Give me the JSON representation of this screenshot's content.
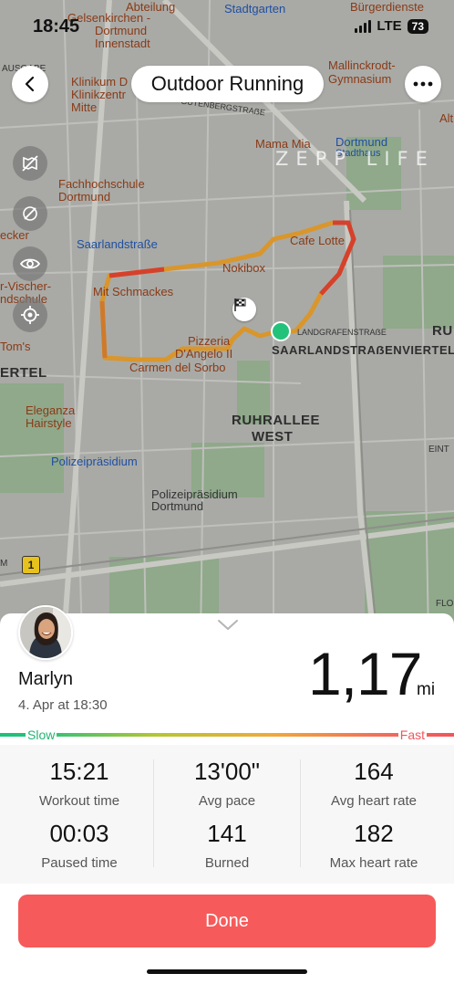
{
  "status": {
    "time": "18:45",
    "network": "LTE",
    "battery": "73"
  },
  "header": {
    "title": "Outdoor Running"
  },
  "watermark": "ZEPP LIFE",
  "map_labels": {
    "abteilung": "Abteilung",
    "gelsenkirchen": "Gelsenkirchen -",
    "dortmund": "Dortmund",
    "innenstadt": "Innenstadt",
    "stadtgarten": "Stadtgarten",
    "burgerdienste": "Bürgerdienste",
    "ausgabe": "AUSGABE",
    "klinikum": "Klinikum D",
    "klinikzentrum": "Klinikzentr",
    "mitte": "Mitte",
    "mallinckrodt": "Mallinckrodt-",
    "gymnasium": "Gymnasium",
    "alt": "Alt",
    "gutenberg": "GUTENBERGSTRAẞE",
    "mamamia": "Mama Mia",
    "dortmund_stadthaus": "Dortmund",
    "stadthaus": "Stadthaus",
    "fachhochschule": "Fachhochschule",
    "fh_dortmund": "Dortmund",
    "ecker": "ecker",
    "saarlandstrasse": "Saarlandstraße",
    "cafe_lotte": "Cafe Lotte",
    "nokibox": "Nokibox",
    "vischer": "r-Vischer-",
    "ndschule": "ndschule",
    "mit_schmackes": "Mit Schmackes",
    "landgrafen": "LANDGRAFENSTRAẞE",
    "ru": "RU",
    "pizzeria": "Pizzeria",
    "dangelo": "D'Angelo II",
    "saarlandviertel": "SAARLANDSTRAẞENVIERTEL",
    "toms": "Tom's",
    "ertel": "ERTEL",
    "carmen": "Carmen del Sorbo",
    "ruhrallee": "RUHRALLEE",
    "west": "WEST",
    "eleganza": "Eleganza",
    "hairstyle": "Hairstyle",
    "polizei": "Polizeipräsidium",
    "polizei2": "Polizeipräsidium",
    "polizei_dortmund": "Dortmund",
    "eint": "EINT",
    "m": "M",
    "flo": "FLO",
    "route_number": "1"
  },
  "profile": {
    "name": "Marlyn",
    "date": "4. Apr at 18:30"
  },
  "distance": {
    "value": "1,17",
    "unit": "mi"
  },
  "speed_scale": {
    "slow": "Slow",
    "fast": "Fast"
  },
  "stats": [
    {
      "value": "15:21",
      "label": "Workout time"
    },
    {
      "value": "13'00\"",
      "label": "Avg pace"
    },
    {
      "value": "164",
      "label": "Avg heart rate"
    },
    {
      "value": "00:03",
      "label": "Paused time"
    },
    {
      "value": "141",
      "label": "Burned"
    },
    {
      "value": "182",
      "label": "Max heart rate"
    }
  ],
  "done_label": "Done",
  "colors": {
    "accent": "#f65a5a",
    "slow": "#22b472",
    "fast": "#f2555a"
  },
  "icons": [
    "back-icon",
    "more-icon",
    "hide-map-icon",
    "layer-off-icon",
    "eye-icon",
    "locate-icon",
    "finish-flag-icon",
    "start-point-icon",
    "chevron-down-icon"
  ]
}
